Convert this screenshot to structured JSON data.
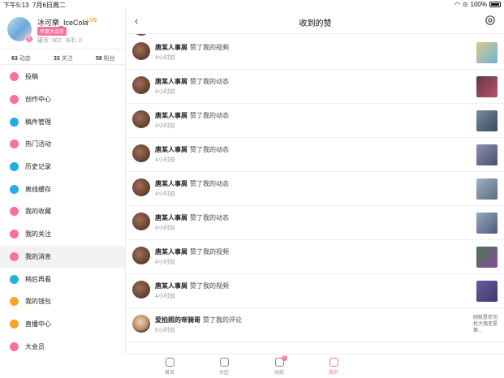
{
  "status_bar": {
    "time": "下午5:13",
    "date": "7月6日周二",
    "battery": "100%"
  },
  "profile": {
    "name": "冰可樂_IceCola",
    "level": "LV5",
    "vip": "年度大会员",
    "coins": "硬币: 302",
    "bcoins": "B币: 0",
    "dynamics": {
      "count": "63",
      "label": "动态"
    },
    "following": {
      "count": "33",
      "label": "关注"
    },
    "fans": {
      "count": "58",
      "label": "粉丝"
    }
  },
  "menu": [
    {
      "label": "投稿",
      "icon": "upload-icon",
      "color": "#fb7299"
    },
    {
      "label": "创作中心",
      "icon": "lightbulb-icon",
      "color": "#fb7299"
    },
    {
      "label": "稿件管理",
      "icon": "play-square-icon",
      "color": "#23ade5"
    },
    {
      "label": "热门活动",
      "icon": "flag-icon",
      "color": "#fb7299"
    },
    {
      "label": "历史记录",
      "icon": "clock-icon",
      "color": "#23ade5"
    },
    {
      "label": "离线缓存",
      "icon": "cloud-download-icon",
      "color": "#23ade5"
    },
    {
      "label": "我的收藏",
      "icon": "star-icon",
      "color": "#fb7299"
    },
    {
      "label": "我的关注",
      "icon": "target-icon",
      "color": "#fb7299"
    },
    {
      "label": "我的消息",
      "icon": "message-icon",
      "color": "#fb7299"
    },
    {
      "label": "稍后再看",
      "icon": "watch-later-icon",
      "color": "#23ade5"
    },
    {
      "label": "我的钱包",
      "icon": "wallet-icon",
      "color": "#f5a623"
    },
    {
      "label": "直播中心",
      "icon": "live-icon",
      "color": "#f5a623"
    },
    {
      "label": "大会员",
      "icon": "vip-icon",
      "color": "#fb7299"
    }
  ],
  "header": {
    "title": "收到的赞"
  },
  "likes": [
    {
      "user": "唐某人事屑",
      "action": "赞了我的视频",
      "time": "4小时前",
      "thumb": [
        "#d8c98a",
        "#6fb3d8"
      ]
    },
    {
      "user": "唐某人事屑",
      "action": "赞了我的动态",
      "time": "4小时前",
      "thumb": [
        "#5a3a4a",
        "#c0506a"
      ]
    },
    {
      "user": "唐某人事屑",
      "action": "赞了我的动态",
      "time": "4小时前",
      "thumb": [
        "#7a8aa0",
        "#3a4a5a"
      ]
    },
    {
      "user": "唐某人事屑",
      "action": "赞了我的动态",
      "time": "4小时前",
      "thumb": [
        "#8a90b0",
        "#4a5070"
      ]
    },
    {
      "user": "唐某人事屑",
      "action": "赞了我的动态",
      "time": "4小时前",
      "thumb": [
        "#a0b0c8",
        "#5a6a80"
      ]
    },
    {
      "user": "唐某人事屑",
      "action": "赞了我的动态",
      "time": "4小时前",
      "thumb": [
        "#9aa8c0",
        "#4a5a78"
      ]
    },
    {
      "user": "唐某人事屑",
      "action": "赞了我的视频",
      "time": "4小时前",
      "thumb": [
        "#4a7a4a",
        "#8a4aa0"
      ]
    },
    {
      "user": "唐某人事屑",
      "action": "赞了我的视频",
      "time": "4小时前",
      "thumb": [
        "#6a5aa0",
        "#3a3a6a"
      ]
    },
    {
      "user": "爱拍照的帝骑哥",
      "action": "赞了我的评论",
      "time": "6小时前",
      "comment": "刚就是老司机大强还是第..."
    }
  ],
  "tabs": [
    {
      "label": "首页",
      "icon": "home-icon"
    },
    {
      "label": "分区",
      "icon": "category-icon"
    },
    {
      "label": "动态",
      "icon": "dynamic-icon",
      "badge": "3"
    },
    {
      "label": "我的",
      "icon": "tv-icon"
    }
  ]
}
